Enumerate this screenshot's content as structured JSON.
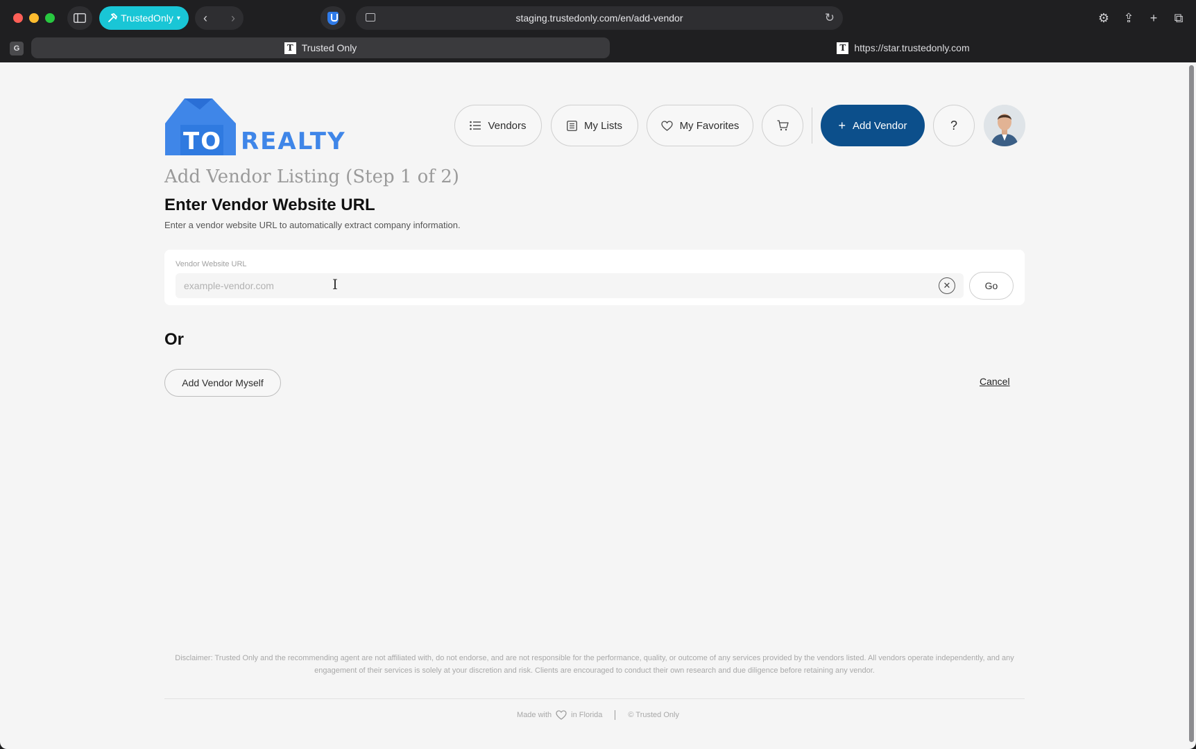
{
  "browser": {
    "profile_label": "TrustedOnly",
    "url": "staging.trustedonly.com/en/add-vendor",
    "tab_badge": "G",
    "tab_favicon_letter": "T",
    "tabs": [
      {
        "label": "Trusted Only"
      },
      {
        "label": "https://star.trustedonly.com"
      }
    ]
  },
  "brand": {
    "logo_part1": "TO",
    "logo_part2": "REALTY",
    "logo_color": "#3f86e8"
  },
  "nav": {
    "vendors": "Vendors",
    "my_lists": "My Lists",
    "my_favorites": "My Favorites",
    "add_vendor": "Add Vendor",
    "help": "?",
    "accent": "#0c4f8b"
  },
  "main": {
    "step_title": "Add Vendor Listing (Step 1 of 2)",
    "section_title": "Enter Vendor Website URL",
    "section_desc": "Enter a vendor website URL to automatically extract company information.",
    "url_field": {
      "label": "Vendor Website URL",
      "placeholder": "example-vendor.com",
      "value": ""
    },
    "go_label": "Go",
    "or_label": "Or",
    "add_myself_label": "Add Vendor Myself",
    "cancel_label": "Cancel"
  },
  "footer": {
    "disclaimer": "Disclaimer: Trusted Only and the recommending agent are not affiliated with, do not endorse, and are not responsible for the performance, quality, or outcome of any services provided by the vendors listed. All vendors operate independently, and any engagement of their services is solely at your discretion and risk. Clients are encouraged to conduct their own research and due diligence before retaining any vendor.",
    "made_with": "Made with",
    "in_florida": "in Florida",
    "copyright": "© Trusted Only"
  }
}
